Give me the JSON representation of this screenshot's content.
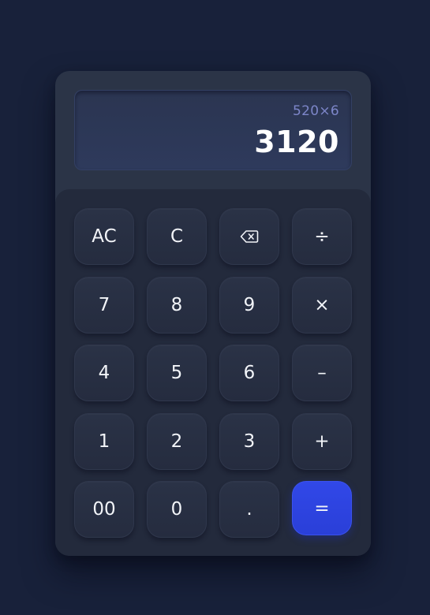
{
  "display": {
    "expression": "520×6",
    "result": "3120"
  },
  "keys": {
    "all_clear": "AC",
    "clear": "C",
    "backspace_icon": "backspace-icon",
    "divide": "÷",
    "seven": "7",
    "eight": "8",
    "nine": "9",
    "multiply": "×",
    "four": "4",
    "five": "5",
    "six": "6",
    "subtract": "–",
    "one": "1",
    "two": "2",
    "three": "3",
    "add": "+",
    "double_zero": "00",
    "zero": "0",
    "decimal": ".",
    "equals": "="
  },
  "colors": {
    "background": "#18213a",
    "body": "#2b3447",
    "keypad": "#232a3c",
    "key": "#2a3246",
    "accent": "#2f45e3",
    "expression_text": "#7d86c9",
    "result_text": "#ffffff"
  }
}
